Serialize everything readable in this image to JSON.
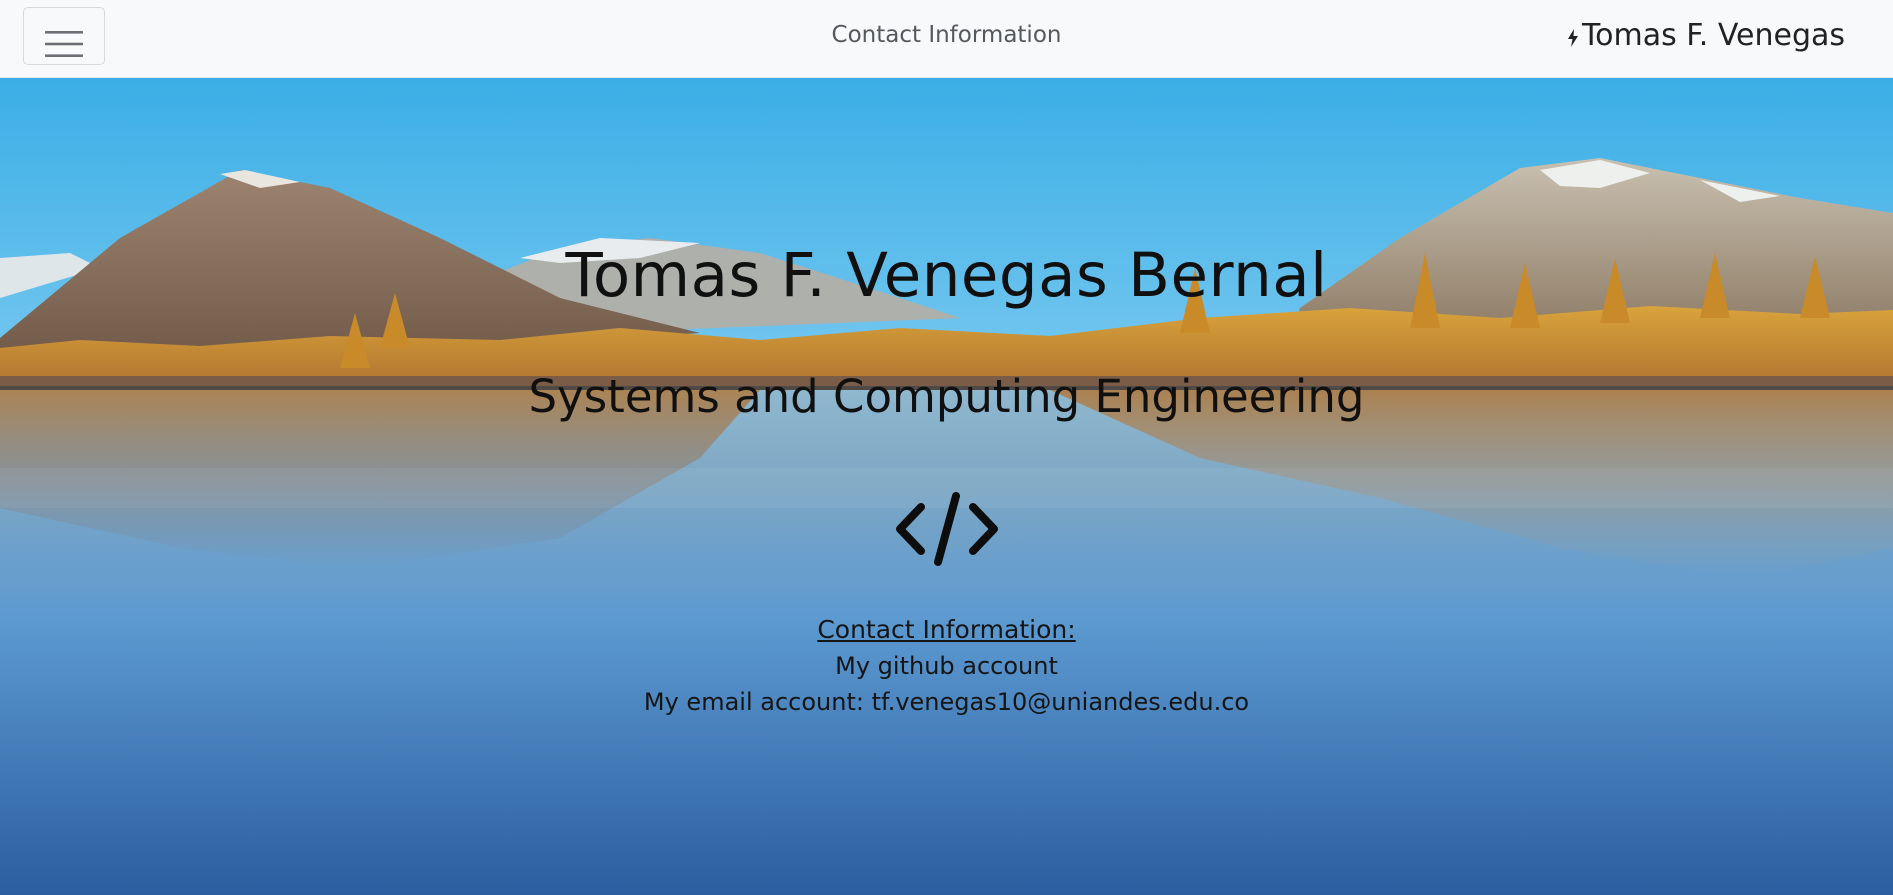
{
  "navbar": {
    "menu_icon": "hamburger-menu-icon",
    "center_link": "Contact Information",
    "brand_icon": "lightning-bolt-icon",
    "brand_name": "Tomas F. Venegas"
  },
  "hero": {
    "background": "mountain-lake-landscape",
    "title": "Tomas F. Venegas Bernal",
    "subtitle": "Systems and Computing Engineering",
    "icon": "code-brackets-icon"
  },
  "contact": {
    "heading": "Contact Information:",
    "github_link": "My github account",
    "email_text": "My email account: tf.venegas10@uniandes.edu.co"
  },
  "colors": {
    "navbar_bg": "#f8f9fa",
    "sky": "#4cb3e6",
    "foliage": "#d0962f",
    "water": "#3b80c0",
    "text": "#101010"
  }
}
